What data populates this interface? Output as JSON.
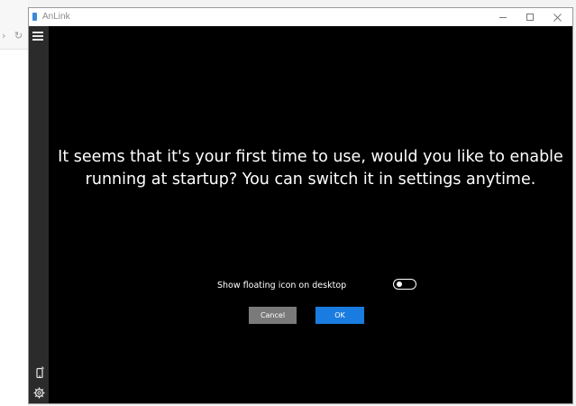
{
  "window": {
    "title": "AnLink"
  },
  "dialog": {
    "message": "It seems that it's your first time to use, would you like to enable running at startup? You can switch it in settings anytime.",
    "toggle_label": "Show floating icon on desktop",
    "toggle_on": false,
    "cancel_label": "Cancel",
    "ok_label": "OK"
  },
  "colors": {
    "content_background": "#000000",
    "side_rail": "#2b2b2b",
    "ok_button": "#1a7ce0",
    "cancel_button": "#7a7a7a"
  },
  "icons": {
    "menu": "hamburger-menu-icon",
    "device": "phone-icon",
    "settings": "gear-icon"
  }
}
